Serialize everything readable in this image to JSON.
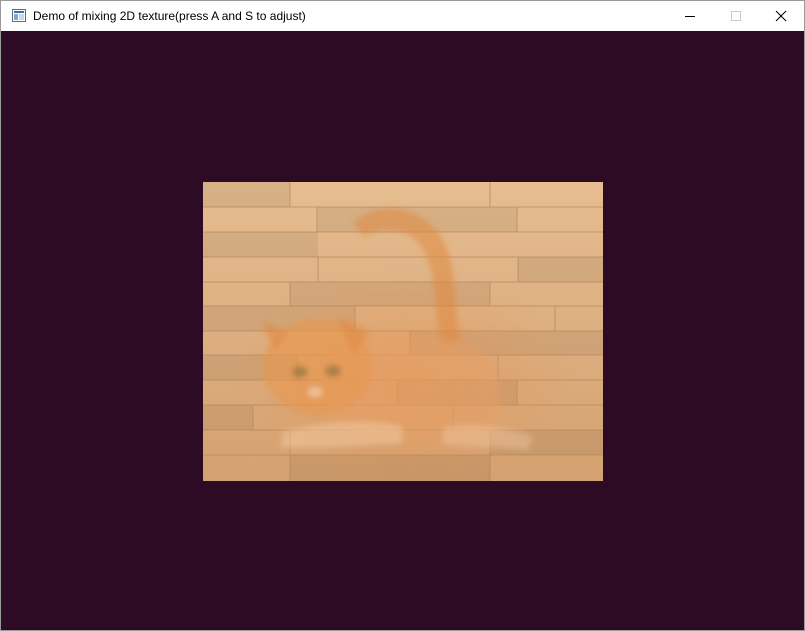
{
  "window": {
    "title": "Demo of mixing 2D texture(press A and S to adjust)",
    "controls": {
      "minimize_icon": "minimize-icon",
      "maximize_icon": "maximize-icon",
      "close_icon": "close-icon"
    }
  },
  "scene": {
    "clear_color": "#2e0b24",
    "textures": [
      "wooden-floor-texture",
      "cat-texture"
    ],
    "colors": {
      "wood_light": "#e4b98a",
      "wood_mid": "#d9a878",
      "wood_seam": "#b98a5e",
      "cat": "#e08a4a"
    }
  }
}
